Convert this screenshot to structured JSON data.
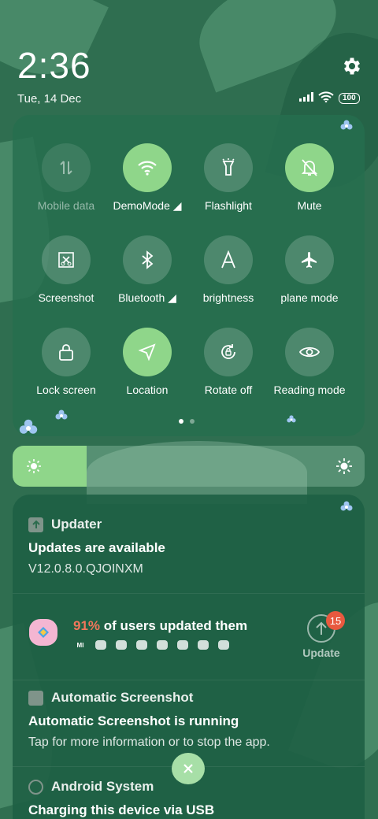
{
  "status": {
    "time": "2:36",
    "date": "Tue, 14 Dec",
    "battery": "100",
    "settings_icon": "gear-icon",
    "signal_icon": "signal-icon",
    "wifi_icon": "wifi-icon"
  },
  "quick_tiles": [
    {
      "label": "Mobile data",
      "icon": "mobile-data-icon",
      "state": "off"
    },
    {
      "label": "DemoMode",
      "icon": "wifi-icon",
      "state": "on"
    },
    {
      "label": "Flashlight",
      "icon": "flashlight-icon",
      "state": "normal"
    },
    {
      "label": "Mute",
      "icon": "bell-off-icon",
      "state": "on"
    },
    {
      "label": "Screenshot",
      "icon": "scissors-icon",
      "state": "normal"
    },
    {
      "label": "Bluetooth",
      "icon": "bluetooth-icon",
      "state": "normal"
    },
    {
      "label": "brightness",
      "icon": "auto-brightness-icon",
      "state": "normal"
    },
    {
      "label": "plane mode",
      "icon": "airplane-icon",
      "state": "normal"
    },
    {
      "label": "Lock screen",
      "icon": "lock-icon",
      "state": "normal"
    },
    {
      "label": "Location",
      "icon": "location-arrow-icon",
      "state": "on"
    },
    {
      "label": "Rotate off",
      "icon": "rotate-lock-icon",
      "state": "normal"
    },
    {
      "label": "Reading mode",
      "icon": "eye-icon",
      "state": "normal"
    }
  ],
  "page_indicator": {
    "pages": 2,
    "current": 1
  },
  "brightness": {
    "level": 0.21,
    "min_icon": "sun-dim-icon",
    "max_icon": "sun-icon"
  },
  "notifications": {
    "updater": {
      "app": "Updater",
      "title": "Updates are available",
      "text": "V12.0.8.0.QJOINXM",
      "percent": "91%",
      "stat_text": " of users updated them",
      "button": "Update",
      "badge": "15",
      "mini_icon_first": "MI"
    },
    "screenshot": {
      "app": "Automatic Screenshot",
      "title": "Automatic Screenshot is running",
      "text": "Tap for more information or to stop the app."
    },
    "android": {
      "app": "Android System",
      "title": "Charging this device via USB"
    }
  },
  "colors": {
    "accent": "#8fd68a",
    "badge": "#e8593f",
    "percent": "#f2765b",
    "background": "#2f6e50"
  }
}
